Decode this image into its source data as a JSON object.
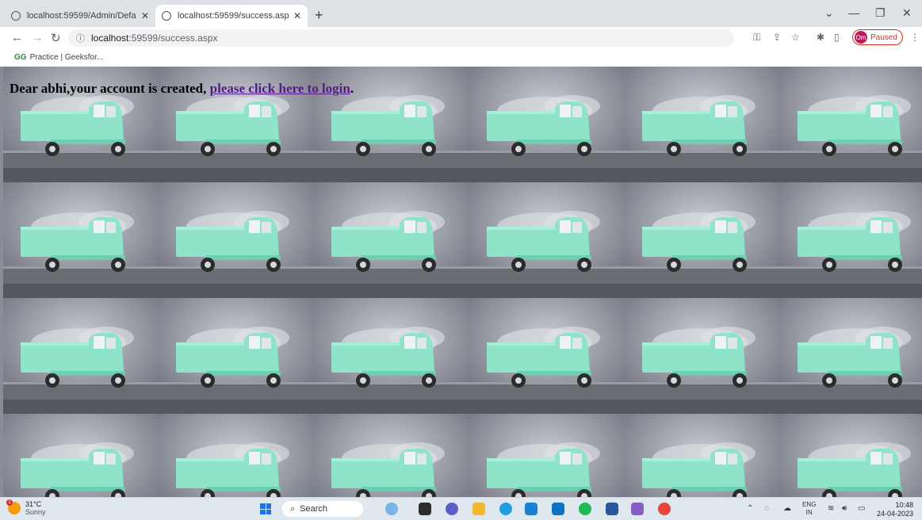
{
  "browser": {
    "tabs": [
      {
        "title": "localhost:59599/Admin/Default.a",
        "active": false
      },
      {
        "title": "localhost:59599/success.aspx",
        "active": true
      }
    ],
    "address": {
      "host": "localhost",
      "path": ":59599/success.aspx"
    },
    "profile_status": "Paused",
    "profile_initials": "Om",
    "bookmark": "Practice | Geeksfor...",
    "bookmark_icon": "GG"
  },
  "page": {
    "message_prefix": "Dear abhi,your account is created, ",
    "login_link": "please click here to login",
    "message_suffix": "."
  },
  "taskbar": {
    "weather_temp": "31°C",
    "weather_cond": "Sunny",
    "weather_badge": "1",
    "search_placeholder": "Search",
    "lang_top": "ENG",
    "lang_bottom": "IN",
    "time": "10:48",
    "date": "24-04-2023"
  },
  "colors": {
    "accent": "#1a73e8",
    "link": "#551a8b",
    "vehicle": "#8ee3c8"
  }
}
